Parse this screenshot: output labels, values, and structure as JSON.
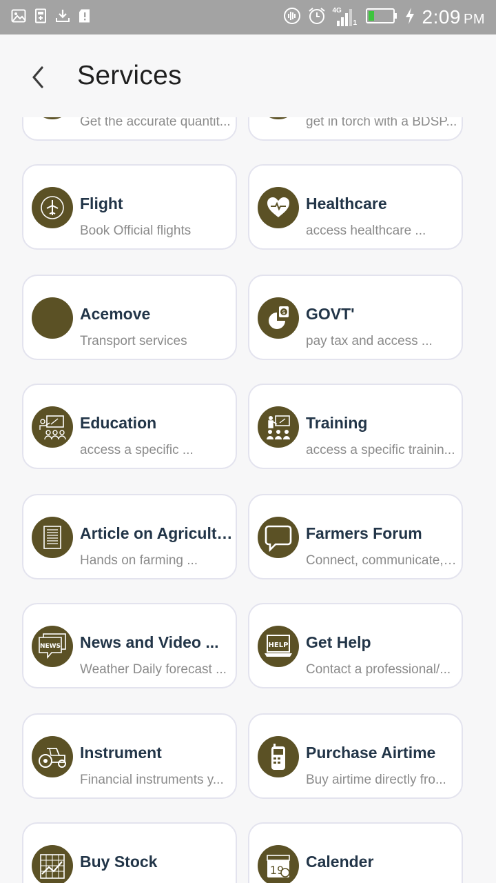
{
  "status_bar": {
    "time": "2:09",
    "ampm": "PM",
    "network": "4G",
    "sim": "1"
  },
  "header": {
    "title": "Services"
  },
  "services": [
    {
      "name": "",
      "desc": "Get the accurate quantit...",
      "icon": "partial-icon"
    },
    {
      "name": "",
      "desc": "get in torch with a BDSP...",
      "icon": "partial-icon"
    },
    {
      "name": "Flight",
      "desc": "Book Official flights",
      "icon": "airplane-icon"
    },
    {
      "name": "Healthcare",
      "desc": "access healthcare ...",
      "icon": "heart-pulse-icon"
    },
    {
      "name": "Acemove",
      "desc": "Transport services",
      "icon": "blank-icon"
    },
    {
      "name": "GOVT'",
      "desc": "pay tax and access ...",
      "icon": "tax-pie-icon"
    },
    {
      "name": "Education",
      "desc": "access a specific ...",
      "icon": "classroom-icon"
    },
    {
      "name": "Training",
      "desc": "access a specific trainin...",
      "icon": "training-icon"
    },
    {
      "name": "Article on Agriculture",
      "desc": "Hands on farming ...",
      "icon": "article-icon"
    },
    {
      "name": "Farmers Forum",
      "desc": "Connect, communicate, ...",
      "icon": "chat-bubble-icon"
    },
    {
      "name": "News and Video ...",
      "desc": "Weather Daily forecast ...",
      "icon": "news-icon"
    },
    {
      "name": "Get Help",
      "desc": "Contact a professional/...",
      "icon": "help-laptop-icon"
    },
    {
      "name": "Instrument",
      "desc": "Financial instruments y...",
      "icon": "tractor-icon"
    },
    {
      "name": "Purchase Airtime",
      "desc": "Buy airtime directly fro...",
      "icon": "phone-icon"
    },
    {
      "name": "Buy Stock",
      "desc": "",
      "icon": "stock-chart-icon"
    },
    {
      "name": "Calender",
      "desc": "",
      "icon": "calendar-icon"
    }
  ],
  "icon_labels": {
    "news": "NEWS",
    "help": "HELP",
    "calendar_day": "19"
  },
  "colors": {
    "icon_bg": "#5b5125",
    "title_text": "#223548",
    "desc_text": "#8b8b8b",
    "card_border": "#e3e3ee",
    "status_bar": "#a3a3a3"
  }
}
